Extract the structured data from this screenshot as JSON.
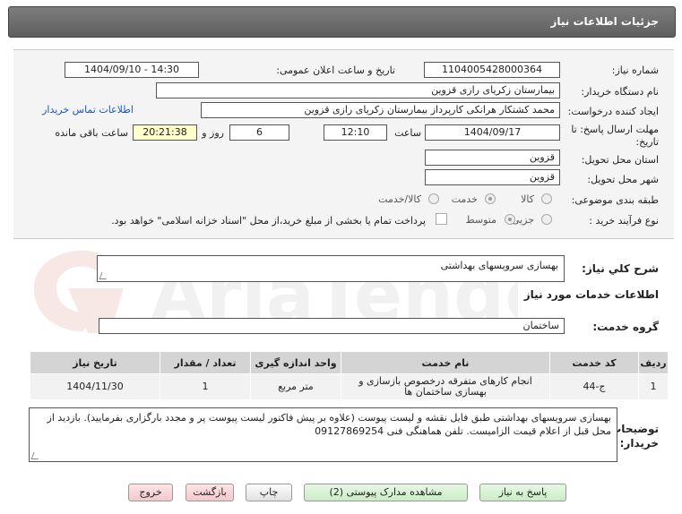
{
  "header": {
    "title": "جزئیات اطلاعات نیاز"
  },
  "form": {
    "need_number_label": "شماره نیاز:",
    "need_number": "1104005428000364",
    "announce_label": "تاریخ و ساعت اعلان عمومی:",
    "announce_value": "1404/09/10 - 14:30",
    "buyer_org_label": "نام دستگاه خریدار:",
    "buyer_org": "بیمارستان زکریای رازی قزوین",
    "creator_label": "ایجاد کننده درخواست:",
    "creator": "محمد کشتکار هرانکی کارپرداز بیمارستان زکریای رازی قزوین",
    "contact_link": "اطلاعات تماس خریدار",
    "deadline_label_1": "مهلت ارسال پاسخ: تا",
    "deadline_label_2": "تاریخ:",
    "deadline_date": "1404/09/17",
    "time_label": "ساعت",
    "deadline_time": "12:10",
    "days_value": "6",
    "days_label": "روز و",
    "remaining_time": "20:21:38",
    "remaining_label": "ساعت باقی مانده",
    "province_label": "استان محل تحویل:",
    "province": "قزوین",
    "city_label": "شهر محل تحویل:",
    "city": "قزوین",
    "category_label": "طبقه بندی موضوعی:",
    "category_options": [
      "کالا",
      "خدمت",
      "کالا/خدمت"
    ],
    "category_selected": "خدمت",
    "process_label": "نوع فرآیند خرید :",
    "process_options": [
      "جزیی",
      "متوسط"
    ],
    "process_selected": "جزیی",
    "payment_note": "پرداخت تمام یا بخشی از مبلغ خرید،از محل \"اسناد خزانه اسلامی\" خواهد بود."
  },
  "need": {
    "general_desc_label": "شرح کلي نیاز:",
    "general_desc": "بهسازی سرویسهای بهداشتی",
    "services_title": "اطلاعات خدمات مورد نیاز",
    "service_group_label": "گروه خدمت:",
    "service_group": "ساختمان"
  },
  "table": {
    "headers": [
      "ردیف",
      "کد خدمت",
      "نام خدمت",
      "واحد اندازه گیری",
      "تعداد / مقدار",
      "تاریخ نیاز"
    ],
    "rows": [
      {
        "row": "1",
        "code": "ج-44",
        "name": "انجام کارهای متفرقه درخصوص بازسازی و بهسازی ساختمان ها",
        "unit": "متر مربع",
        "qty": "1",
        "date": "1404/11/30"
      }
    ]
  },
  "buyer_notes": {
    "label_1": "توضیحات",
    "label_2": "خریدار:",
    "text": "بهسازی سرویسهای بهداشتی طبق فایل نقشه و لیست پیوست (علاوه بر پیش فاکتور لیست پیوست پر و مجدد بارگزاری بفرمایید). بازدید از محل قبل از اعلام قیمت الزامیست. تلفن هماهنگی فنی 09127869254"
  },
  "buttons": {
    "reply": "پاسخ به نیاز",
    "docs": "مشاهده مدارک پیوستی (2)",
    "print": "چاپ",
    "back": "بازگشت",
    "exit": "خروج"
  },
  "watermark": "AriaTender.neT"
}
